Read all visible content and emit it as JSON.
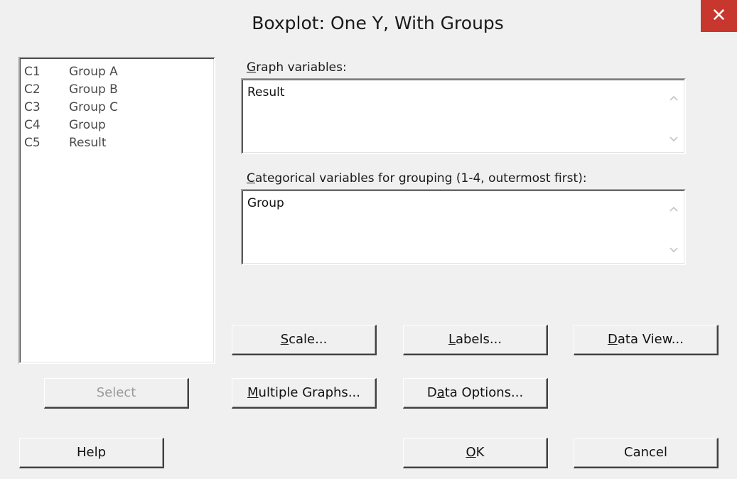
{
  "window": {
    "title": "Boxplot: One Y, With Groups",
    "close_glyph": "✕"
  },
  "variables": [
    {
      "col": "C1",
      "name": "Group A"
    },
    {
      "col": "C2",
      "name": "Group B"
    },
    {
      "col": "C3",
      "name": "Group C"
    },
    {
      "col": "C4",
      "name": "Group"
    },
    {
      "col": "C5",
      "name": "Result"
    }
  ],
  "graph_variables": {
    "label_accel": "G",
    "label_rest": "raph variables:",
    "value": "Result"
  },
  "categorical": {
    "label_accel": "C",
    "label_rest": "ategorical variables for grouping (1-4, outermost first):",
    "value": "Group"
  },
  "buttons": {
    "scale": {
      "accel": "S",
      "rest": "cale..."
    },
    "labels": {
      "accel": "L",
      "rest": "abels..."
    },
    "data_view": {
      "accel": "D",
      "rest": "ata View..."
    },
    "select": {
      "label": "Select"
    },
    "multiple_graphs": {
      "accel": "M",
      "rest": "ultiple Graphs..."
    },
    "data_options": {
      "pre": "D",
      "accel": "a",
      "rest": "ta Options..."
    },
    "help": {
      "label": "Help"
    },
    "ok": {
      "accel": "O",
      "rest": "K"
    },
    "cancel": {
      "label": "Cancel"
    }
  },
  "icons": {
    "scroll_up": "chevron-up-icon",
    "scroll_down": "chevron-down-icon",
    "close": "close-icon"
  },
  "colors": {
    "close_bg": "#c8372d",
    "dialog_bg": "#f0f0f0",
    "disabled_text": "#9a9a9a"
  }
}
